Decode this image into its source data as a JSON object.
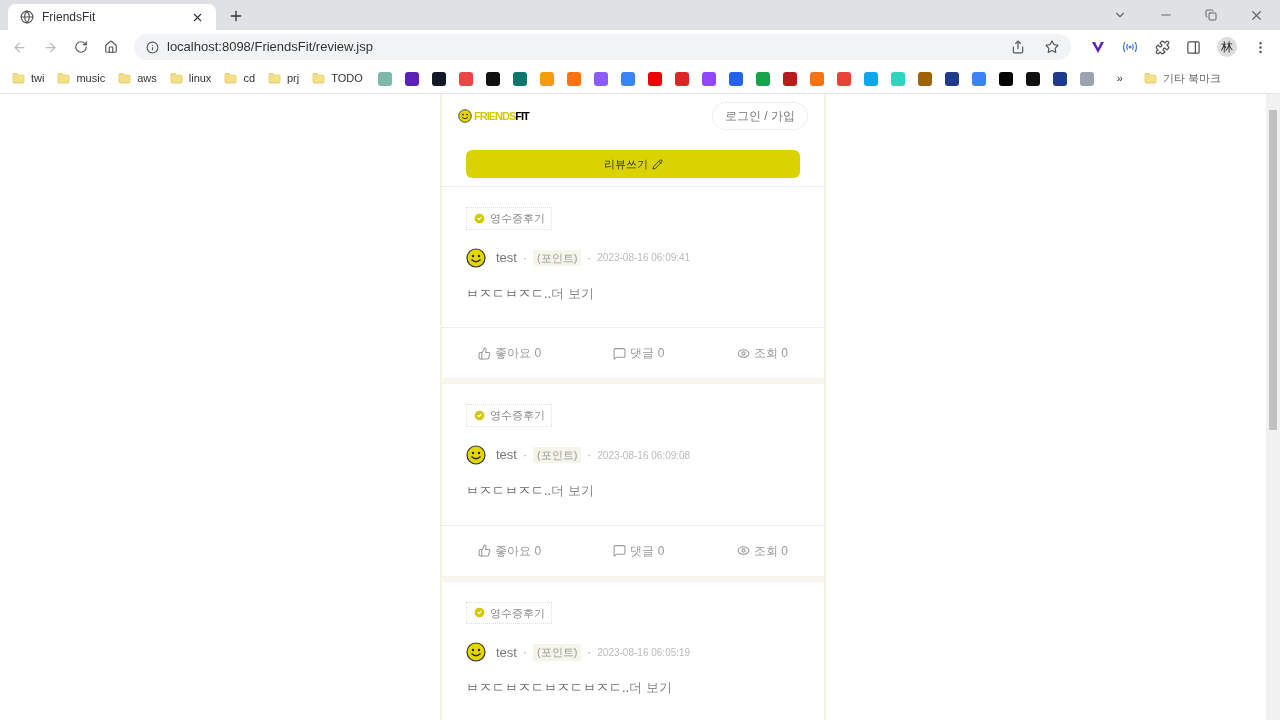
{
  "browser": {
    "tab_title": "FriendsFit",
    "url": "localhost:8098/FriendsFit/review.jsp",
    "bookmark_folders": [
      "twi",
      "music",
      "aws",
      "linux",
      "cd",
      "prj",
      "TODO"
    ],
    "more": "»",
    "other_bookmarks": "기타 북마크",
    "profile": "林"
  },
  "header": {
    "logo_part1": "FRIENDS",
    "logo_part2": "FIT",
    "login": "로그인 / 가입"
  },
  "write_button": "리뷰쓰기",
  "reviews": [
    {
      "badge": "영수증후기",
      "user": "test",
      "sep1": "·",
      "grade": "(포인트)",
      "sep2": "·",
      "date": "2023-08-16 06:09:41",
      "body": "ㅂㅈㄷㅂㅈㄷ..",
      "more": "더 보기",
      "likes": "좋아요 0",
      "comments": "댓글 0",
      "views": "조회 0"
    },
    {
      "badge": "영수증후기",
      "user": "test",
      "sep1": "·",
      "grade": "(포인트)",
      "sep2": "·",
      "date": "2023-08-16 06:09:08",
      "body": "ㅂㅈㄷㅂㅈㄷ..",
      "more": "더 보기",
      "likes": "좋아요 0",
      "comments": "댓글 0",
      "views": "조회 0"
    },
    {
      "badge": "영수증후기",
      "user": "test",
      "sep1": "·",
      "grade": "(포인트)",
      "sep2": "·",
      "date": "2023-08-16 06:05:19",
      "body": "ㅂㅈㄷㅂㅈㄷㅂㅈㄷㅂㅈㄷ..",
      "more": "더 보기"
    }
  ]
}
